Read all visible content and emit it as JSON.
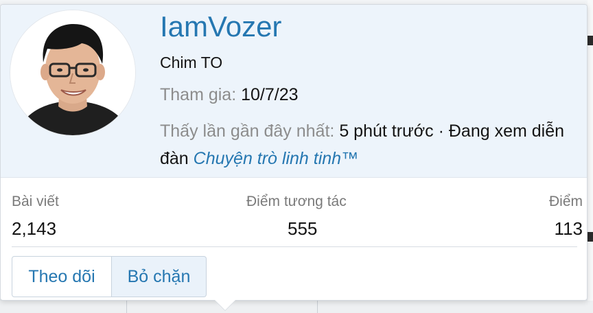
{
  "profile": {
    "username": "IamVozer",
    "user_title": "Chim TO",
    "joined_label": "Tham gia:",
    "joined_value": "10/7/23",
    "last_seen_label": "Thấy lần gần đây nhất:",
    "last_seen_value": "5 phút trước · Đang xem diễn đàn",
    "last_seen_forum": "Chuyện trò linh tinh™"
  },
  "stats": {
    "posts_label": "Bài viết",
    "posts_value": "2,143",
    "reactions_label": "Điểm tương tác",
    "reactions_value": "555",
    "points_label": "Điểm",
    "points_value": "113"
  },
  "actions": {
    "follow_label": "Theo dõi",
    "unblock_label": "Bỏ chặn"
  },
  "colors": {
    "accent": "#2577b1",
    "header_bg": "#edf4fb",
    "muted_text": "#8c8c8c"
  }
}
